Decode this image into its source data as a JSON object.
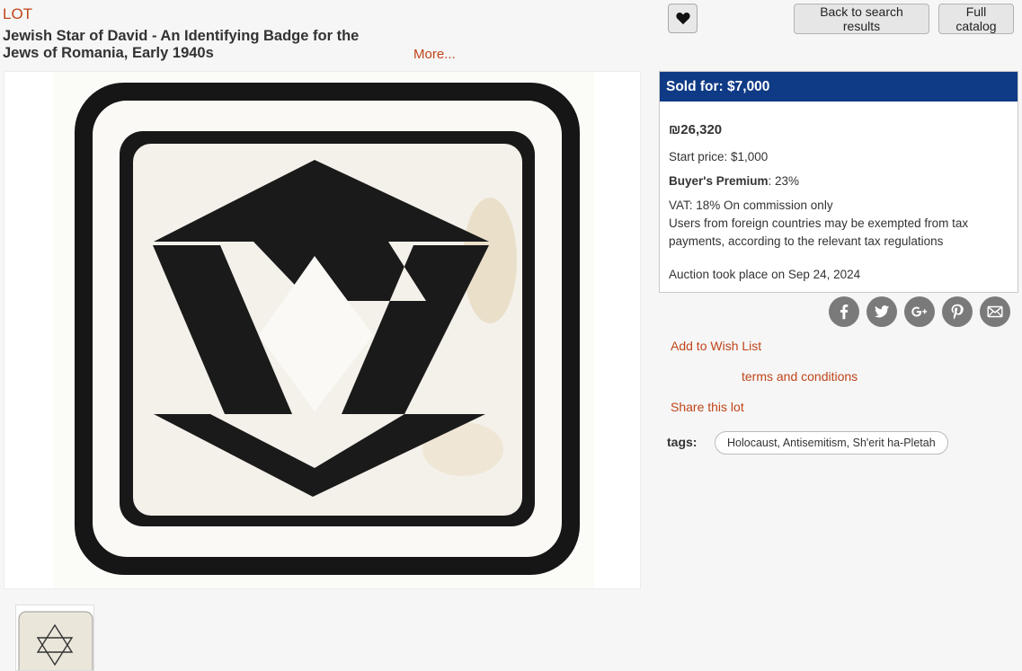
{
  "header": {
    "lot_label": "LOT",
    "title_line1": "Jewish Star of David - An Identifying Badge for the",
    "title_line2": "Jews of Romania, Early 1940s",
    "more_label": "More..."
  },
  "toolbar": {
    "favorite_icon": "heart-icon",
    "back_label": "Back to search results",
    "catalog_label": "Full catalog"
  },
  "price": {
    "sold_label": "Sold for: $7,000",
    "ils_value": "₪26,320",
    "start_price": "Start price: $1,000",
    "premium_label": "Buyer's Premium",
    "premium_value": ": 23%",
    "vat_line": "VAT: 18% On commission only",
    "tax_line1": "Users from foreign countries may be exempted from tax",
    "tax_line2": "payments, according to the relevant tax regulations",
    "auction_date": "Auction took place on Sep 24, 2024"
  },
  "social": [
    "facebook-icon",
    "twitter-icon",
    "google-plus-icon",
    "pinterest-icon",
    "email-icon"
  ],
  "links": {
    "wishlist": "Add to Wish List",
    "terms": "terms and conditions",
    "share": "Share this lot"
  },
  "tags": {
    "label": "tags:",
    "items": [
      "Holocaust, Antisemitism, Sh'erit ha-Pletah"
    ]
  },
  "colors": {
    "accent": "#c0441a",
    "sold_bar": "#0f3a86",
    "social_icon_bg": "#7a7a7a"
  }
}
